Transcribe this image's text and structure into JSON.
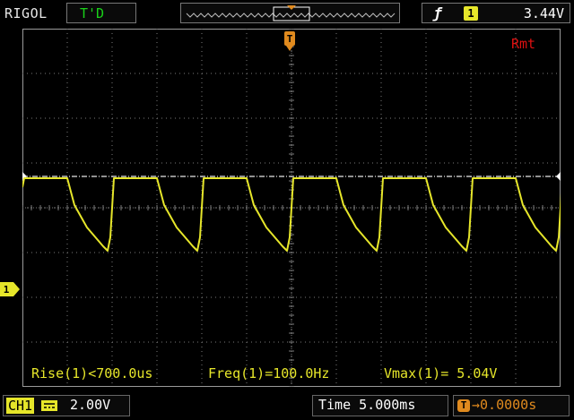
{
  "header": {
    "brand": "RIGOL",
    "run_status": "T'D",
    "trigger": {
      "slope_icon": "rising-edge-icon",
      "source_badge": "1",
      "level": "3.44V"
    },
    "remote_indicator": "Rmt"
  },
  "measurements": [
    {
      "label": "Rise(1)<700.0us"
    },
    {
      "label": "Freq(1)=100.0Hz"
    },
    {
      "label": "Vmax(1)= 5.04V"
    }
  ],
  "footer": {
    "channel_tag": "CH1",
    "coupling_icon": "dc-coupling-icon",
    "volts_per_div": "2.00V",
    "timebase": "Time 5.000ms",
    "trigger_offset": "→0.0000s",
    "offset_icon_glyph": "T"
  },
  "markers": {
    "channel_marker": "1",
    "trigger_marker_glyph": "T"
  },
  "colors": {
    "channel1": "#e6e62a",
    "trigger": "#e08a1e",
    "run_status": "#19d219",
    "remote": "#dd1111",
    "grid": "#7a7a7a"
  }
}
